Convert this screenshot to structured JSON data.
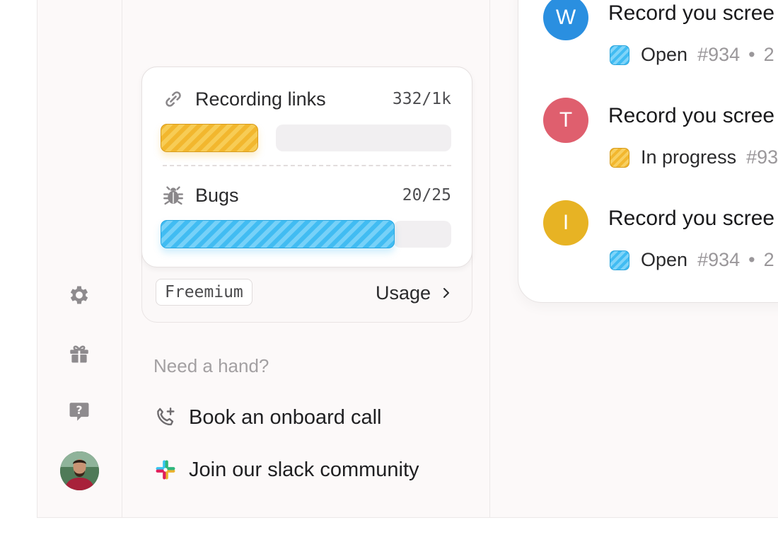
{
  "sidebar": {
    "icons": [
      "settings-gear-icon",
      "gift-icon",
      "help-chat-icon"
    ],
    "avatar": "user-avatar"
  },
  "usage": {
    "metrics": [
      {
        "label": "Recording links",
        "count": "332/1k",
        "fill": 0.332,
        "color": "#f2b72e",
        "icon": "link-icon"
      },
      {
        "label": "Bugs",
        "count": "20/25",
        "fill": 0.8,
        "color": "#41bcf2",
        "icon": "bug-icon"
      }
    ],
    "plan": "Freemium",
    "link_label": "Usage"
  },
  "help": {
    "heading": "Need a hand?",
    "items": [
      {
        "label": "Book an onboard call",
        "icon": "phone-plus-icon"
      },
      {
        "label": "Join our slack community",
        "icon": "slack-icon"
      }
    ]
  },
  "feed": {
    "items": [
      {
        "initial": "W",
        "avatar_color": "#2a8fe0",
        "title": "Record you scree",
        "status": "Open",
        "status_kind": "open",
        "id": "#934",
        "after": "2"
      },
      {
        "initial": "T",
        "avatar_color": "#df5f6e",
        "title": "Record you scree",
        "status": "In progress",
        "status_kind": "progress",
        "id": "#93",
        "after": ""
      },
      {
        "initial": "I",
        "avatar_color": "#e7b324",
        "title": "Record you scree",
        "status": "Open",
        "status_kind": "open",
        "id": "#934",
        "after": "2"
      }
    ]
  }
}
